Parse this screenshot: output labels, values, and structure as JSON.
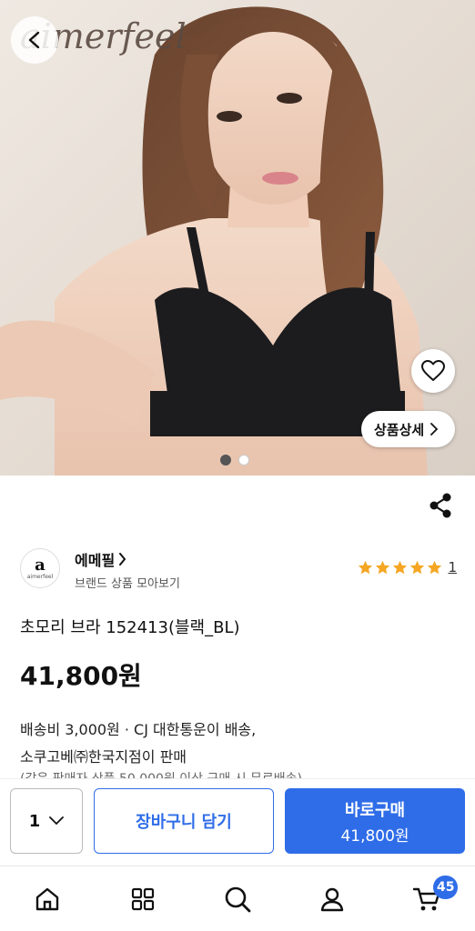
{
  "hero": {
    "brand_watermark": "aimerfeel",
    "detail_label": "상품상세",
    "slides_total": 2,
    "slide_active": 1
  },
  "seller": {
    "logo_letter": "a",
    "logo_sub": "aimerfeel",
    "name": "에메필",
    "sub": "브랜드 상품 모아보기",
    "rating_stars": 5,
    "rating_count": "1"
  },
  "product": {
    "name": "초모리 브라 152413(블랙_BL)",
    "price": "41,800원",
    "shipping_line1": "배송비 3,000원 · CJ 대한통운이 배송,",
    "shipping_line2": "소쿠고베㈜한국지점이 판매",
    "shipping_line3": "(같은 판매자 상품 50,000원 이상 구매 시 무료배송)"
  },
  "buybar": {
    "quantity": "1",
    "cart_label": "장바구니 담기",
    "buy_label": "바로구매",
    "buy_price": "41,800원"
  },
  "nav": {
    "items": [
      "home-icon",
      "category-icon",
      "search-icon",
      "my-page-icon",
      "cart-icon"
    ],
    "cart_badge": "45"
  },
  "colors": {
    "accent": "#2f6de8",
    "star": "#f5a623"
  }
}
